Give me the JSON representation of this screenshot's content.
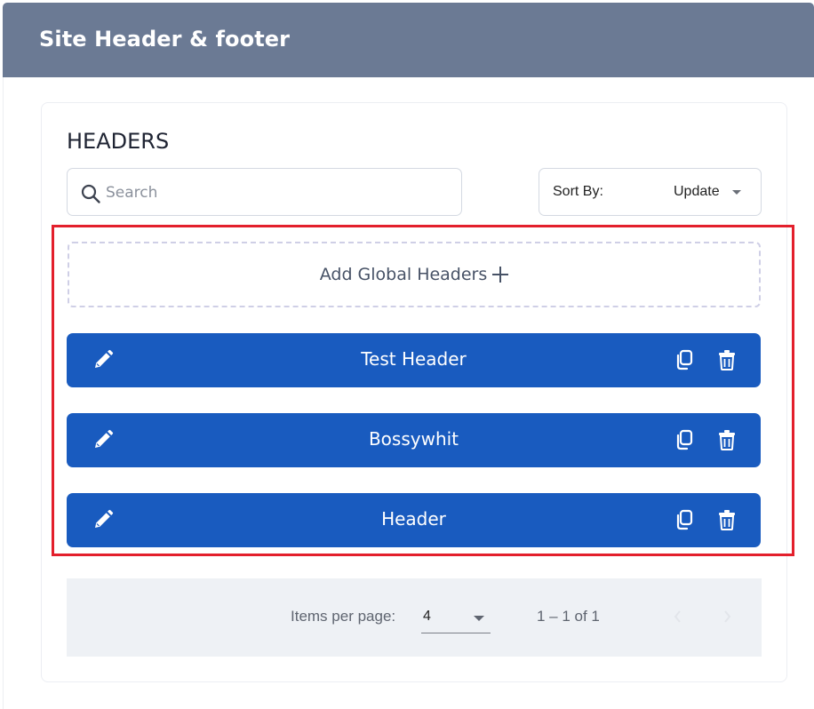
{
  "page": {
    "title": "Site Header & footer"
  },
  "headers_section": {
    "title": "HEADERS",
    "search": {
      "placeholder": "Search",
      "value": ""
    },
    "sort": {
      "label": "Sort By:",
      "value": "Update"
    },
    "add_button_label": "Add Global Headers",
    "items": [
      {
        "name": "Test Header"
      },
      {
        "name": "Bossywhit"
      },
      {
        "name": "Header"
      }
    ]
  },
  "paginator": {
    "items_per_page_label": "Items per page:",
    "items_per_page_value": "4",
    "range_label": "1 – 1 of 1"
  },
  "colors": {
    "header_bar": "#6b7a94",
    "row_blue": "#195bbf",
    "highlight_red": "#e3202c",
    "paginator_bg": "#eef1f5"
  },
  "icons": {
    "search": "search-icon",
    "edit": "pencil-icon",
    "copy": "copy-icon",
    "delete": "trash-icon",
    "add": "plus-icon",
    "dropdown": "caret-down-icon",
    "prev": "chevron-left-icon",
    "next": "chevron-right-icon"
  }
}
